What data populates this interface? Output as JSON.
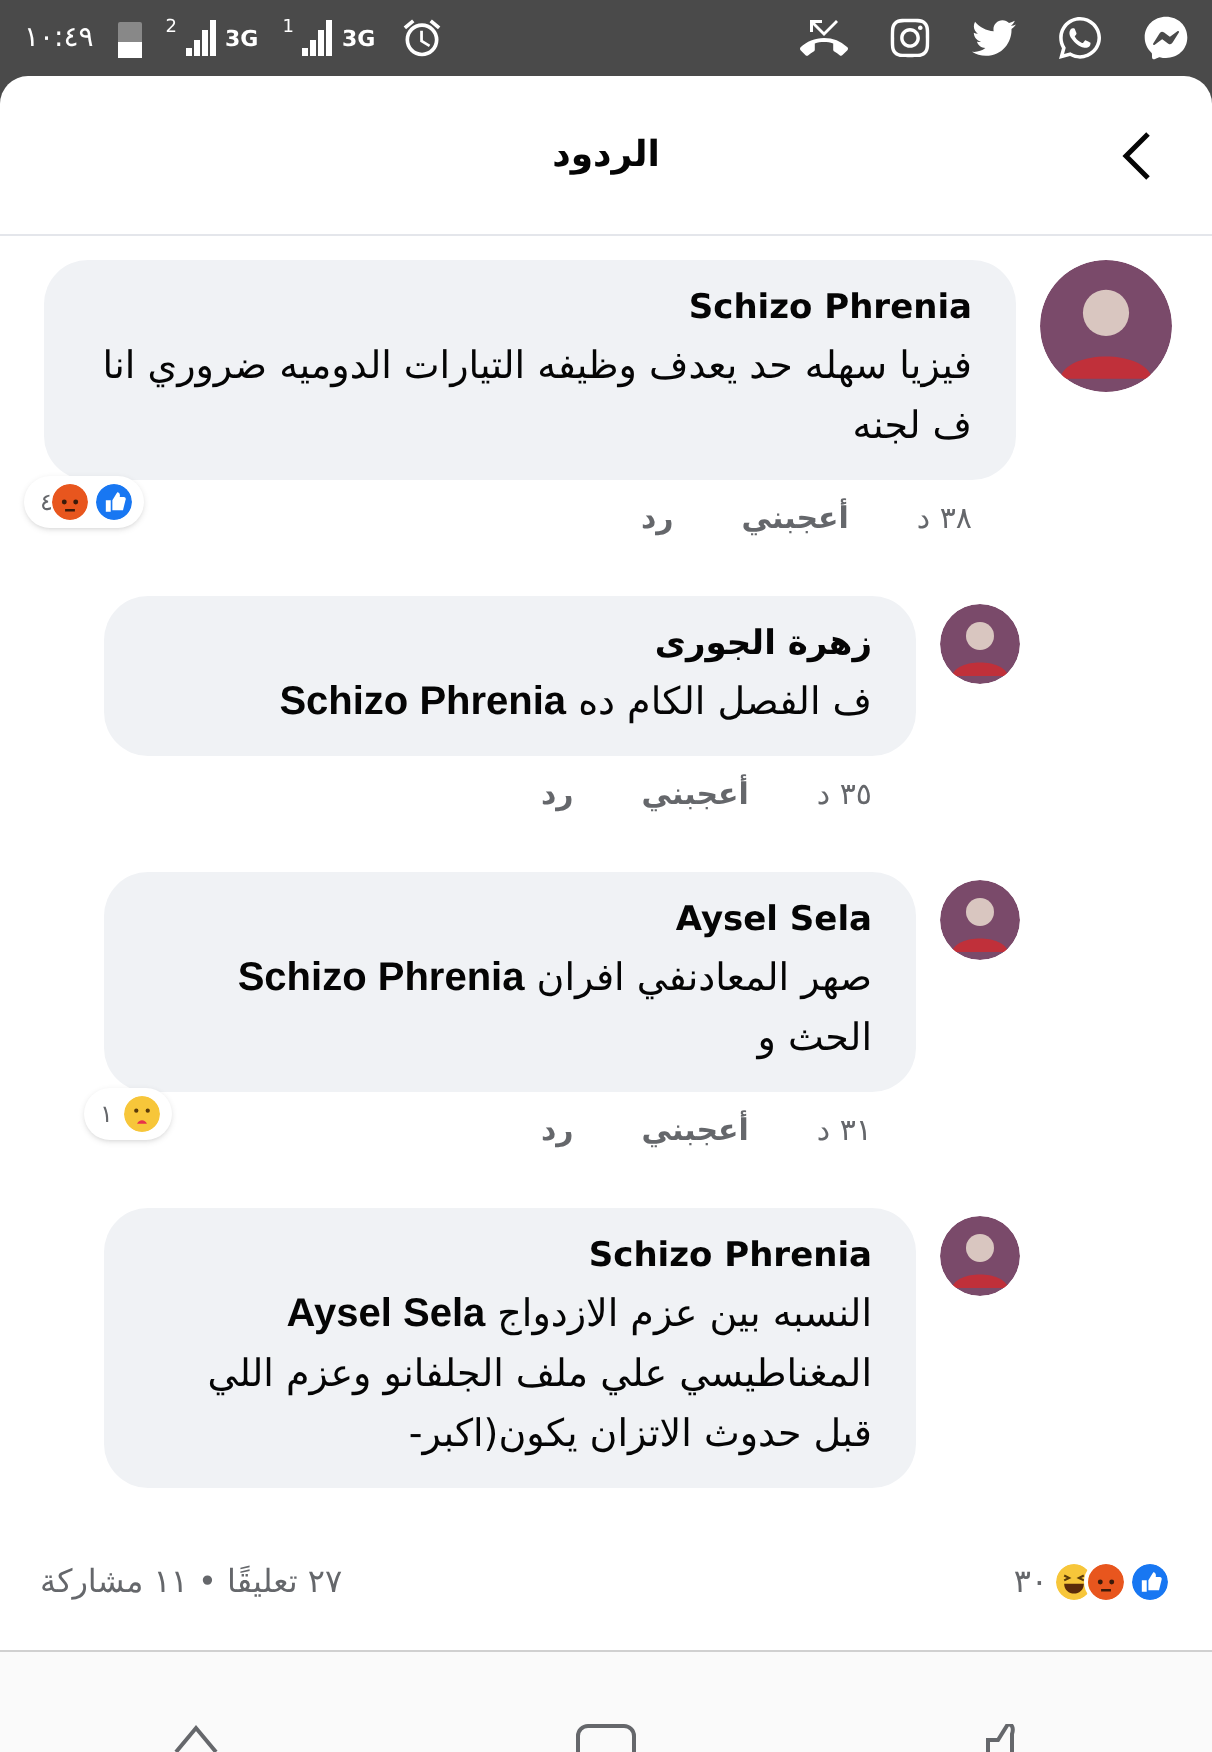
{
  "status_bar": {
    "time": "١٠:٤٩",
    "sims": [
      {
        "slot": "1",
        "network": "3G"
      },
      {
        "slot": "2",
        "network": "3G"
      }
    ]
  },
  "header": {
    "title": "الردود"
  },
  "comments": [
    {
      "author": "Schizo Phrenia",
      "text": "فيزيا سهله حد يعدف وظيفه التيارات الدوميه ضروري انا ف لجنه",
      "time": "٣٨ د",
      "like_label": "أعجبني",
      "reply_label": "رد",
      "reactions": [
        {
          "kind": "like"
        },
        {
          "kind": "angry"
        }
      ],
      "reaction_count": "٤",
      "children": [
        {
          "author": "زهرة الجورى",
          "text": "ف الفصل الكام ده **Schizo Phrenia**",
          "time": "٣٥ د",
          "like_label": "أعجبني",
          "reply_label": "رد"
        },
        {
          "author": "Aysel Sela",
          "text": "صهر المعادنفي افران **Schizo Phrenia** الحث و",
          "time": "٣١ د",
          "like_label": "أعجبني",
          "reply_label": "رد",
          "reactions": [
            {
              "kind": "care"
            }
          ],
          "reaction_count": "١"
        },
        {
          "author": "Schizo Phrenia",
          "text": "النسبه بين عزم الازدواج **Aysel Sela** المغناطيسي علي ملف الجلفانو وعزم اللي قبل حدوث الاتزان يكون(اكبر-"
        }
      ]
    }
  ],
  "footer": {
    "reactions": [
      {
        "kind": "like"
      },
      {
        "kind": "angry"
      },
      {
        "kind": "haha"
      }
    ],
    "reaction_count": "٣٠",
    "stats": "٢٧ تعليقًا • ١١ مشاركة"
  }
}
